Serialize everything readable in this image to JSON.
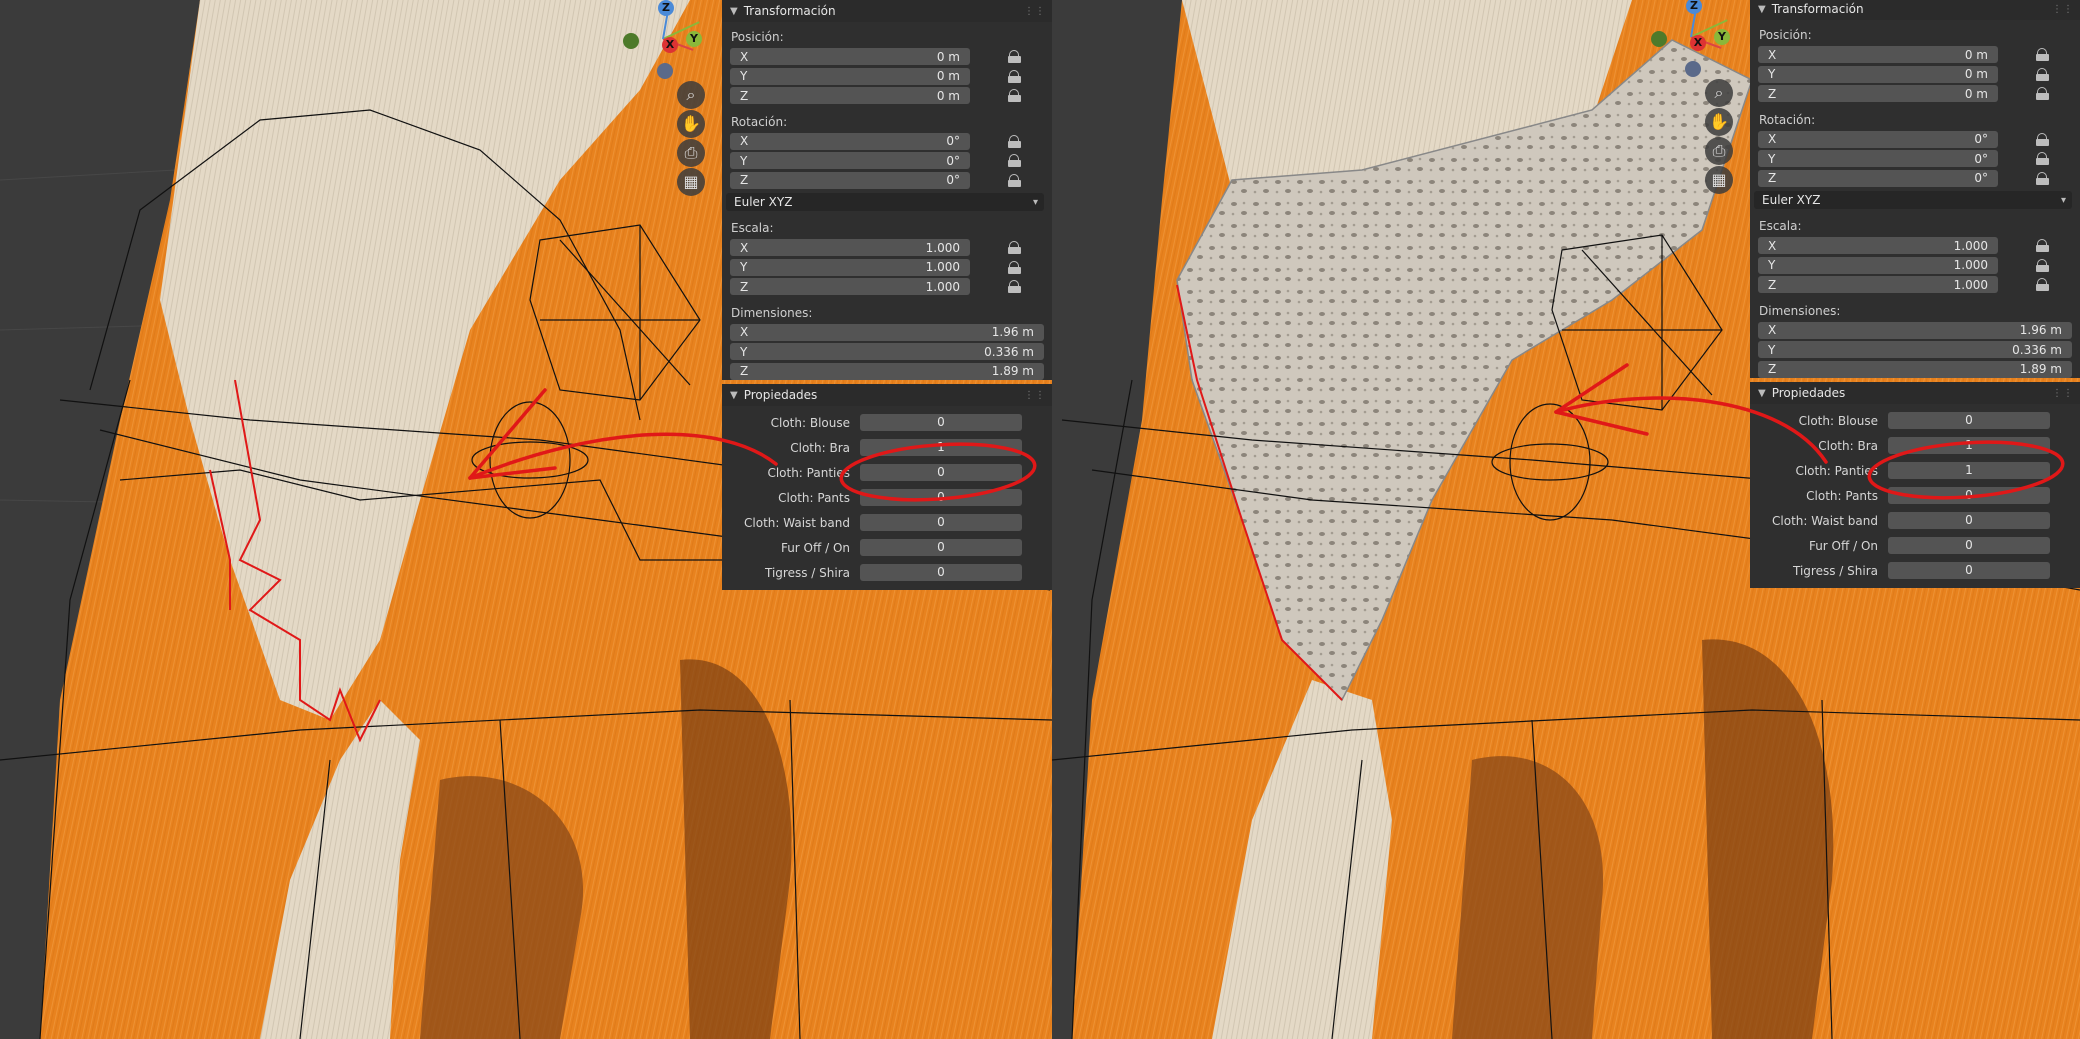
{
  "gizmo": {
    "x": "X",
    "y": "Y",
    "z": "Z"
  },
  "nav_icons": [
    "zoom-icon",
    "hand-icon",
    "camera-icon",
    "grid-icon"
  ],
  "nav_glyphs": [
    "⌕",
    "✋",
    "⎙",
    "▦"
  ],
  "colors": {
    "fur_orange": "#e8821e",
    "fur_white": "#e6dccb",
    "fur_brown": "#7a3f12",
    "panel": "#2f2f2f",
    "field": "#545454",
    "annotation_red": "#e01818"
  },
  "views": [
    {
      "transform": {
        "title": "Transformación",
        "position_label": "Posición:",
        "position": [
          {
            "axis": "X",
            "value": "0 m"
          },
          {
            "axis": "Y",
            "value": "0 m"
          },
          {
            "axis": "Z",
            "value": "0 m"
          }
        ],
        "rotation_label": "Rotación:",
        "rotation": [
          {
            "axis": "X",
            "value": "0°"
          },
          {
            "axis": "Y",
            "value": "0°"
          },
          {
            "axis": "Z",
            "value": "0°"
          }
        ],
        "rotation_mode": "Euler XYZ",
        "scale_label": "Escala:",
        "scale": [
          {
            "axis": "X",
            "value": "1.000"
          },
          {
            "axis": "Y",
            "value": "1.000"
          },
          {
            "axis": "Z",
            "value": "1.000"
          }
        ],
        "dimensions_label": "Dimensiones:",
        "dimensions": [
          {
            "axis": "X",
            "value": "1.96 m"
          },
          {
            "axis": "Y",
            "value": "0.336 m"
          },
          {
            "axis": "Z",
            "value": "1.89 m"
          }
        ]
      },
      "properties": {
        "title": "Propiedades",
        "items": [
          {
            "label": "Cloth: Blouse",
            "value": "0"
          },
          {
            "label": "Cloth: Bra",
            "value": "1"
          },
          {
            "label": "Cloth: Panties",
            "value": "0"
          },
          {
            "label": "Cloth: Pants",
            "value": "0"
          },
          {
            "label": "Cloth: Waist band",
            "value": "0"
          },
          {
            "label": "Fur Off / On",
            "value": "0"
          },
          {
            "label": "Tigress / Shira",
            "value": "0"
          }
        ]
      }
    },
    {
      "transform": {
        "title": "Transformación",
        "position_label": "Posición:",
        "position": [
          {
            "axis": "X",
            "value": "0 m"
          },
          {
            "axis": "Y",
            "value": "0 m"
          },
          {
            "axis": "Z",
            "value": "0 m"
          }
        ],
        "rotation_label": "Rotación:",
        "rotation": [
          {
            "axis": "X",
            "value": "0°"
          },
          {
            "axis": "Y",
            "value": "0°"
          },
          {
            "axis": "Z",
            "value": "0°"
          }
        ],
        "rotation_mode": "Euler XYZ",
        "scale_label": "Escala:",
        "scale": [
          {
            "axis": "X",
            "value": "1.000"
          },
          {
            "axis": "Y",
            "value": "1.000"
          },
          {
            "axis": "Z",
            "value": "1.000"
          }
        ],
        "dimensions_label": "Dimensiones:",
        "dimensions": [
          {
            "axis": "X",
            "value": "1.96 m"
          },
          {
            "axis": "Y",
            "value": "0.336 m"
          },
          {
            "axis": "Z",
            "value": "1.89 m"
          }
        ]
      },
      "properties": {
        "title": "Propiedades",
        "items": [
          {
            "label": "Cloth: Blouse",
            "value": "0"
          },
          {
            "label": "Cloth: Bra",
            "value": "1"
          },
          {
            "label": "Cloth: Panties",
            "value": "1"
          },
          {
            "label": "Cloth: Pants",
            "value": "0"
          },
          {
            "label": "Cloth: Waist band",
            "value": "0"
          },
          {
            "label": "Fur Off / On",
            "value": "0"
          },
          {
            "label": "Tigress / Shira",
            "value": "0"
          }
        ]
      }
    }
  ]
}
